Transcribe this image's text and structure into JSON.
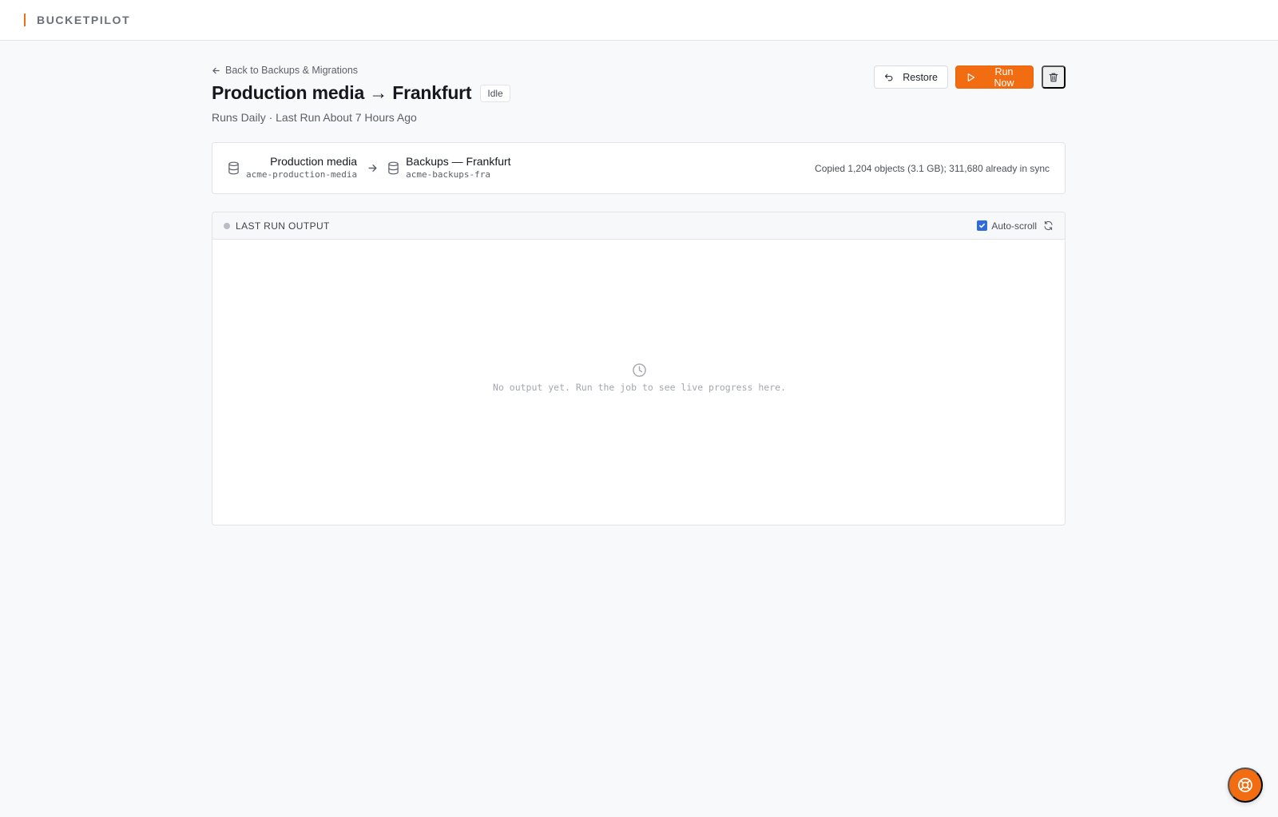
{
  "app": {
    "brand": "BUCKETPILOT"
  },
  "nav": {
    "back_label": "Back to Backups & Migrations"
  },
  "job": {
    "title": "Production media → Frankfurt",
    "status": "Idle",
    "subtitle": "Runs Daily · Last Run About 7 Hours Ago"
  },
  "actions": {
    "restore_label": "Restore",
    "run_label": "Run Now"
  },
  "route": {
    "source": {
      "name": "Production media",
      "bucket": "acme-production-media"
    },
    "destination": {
      "name": "Backups — Frankfurt",
      "bucket": "acme-backups-fra"
    },
    "summary": "Copied 1,204 objects (3.1 GB); 311,680 already in sync"
  },
  "output": {
    "title": "LAST RUN OUTPUT",
    "autoscroll_label": "Auto-scroll",
    "autoscroll_checked": true,
    "empty_message": "No output yet. Run the job to see live progress here."
  },
  "colors": {
    "accent": "#f26d12",
    "checkbox": "#2f6bd9"
  },
  "icons": [
    "arrow-left-icon",
    "undo-icon",
    "play-icon",
    "trash-icon",
    "database-icon",
    "arrow-right-icon",
    "refresh-icon",
    "clock-icon",
    "lifebuoy-icon"
  ]
}
